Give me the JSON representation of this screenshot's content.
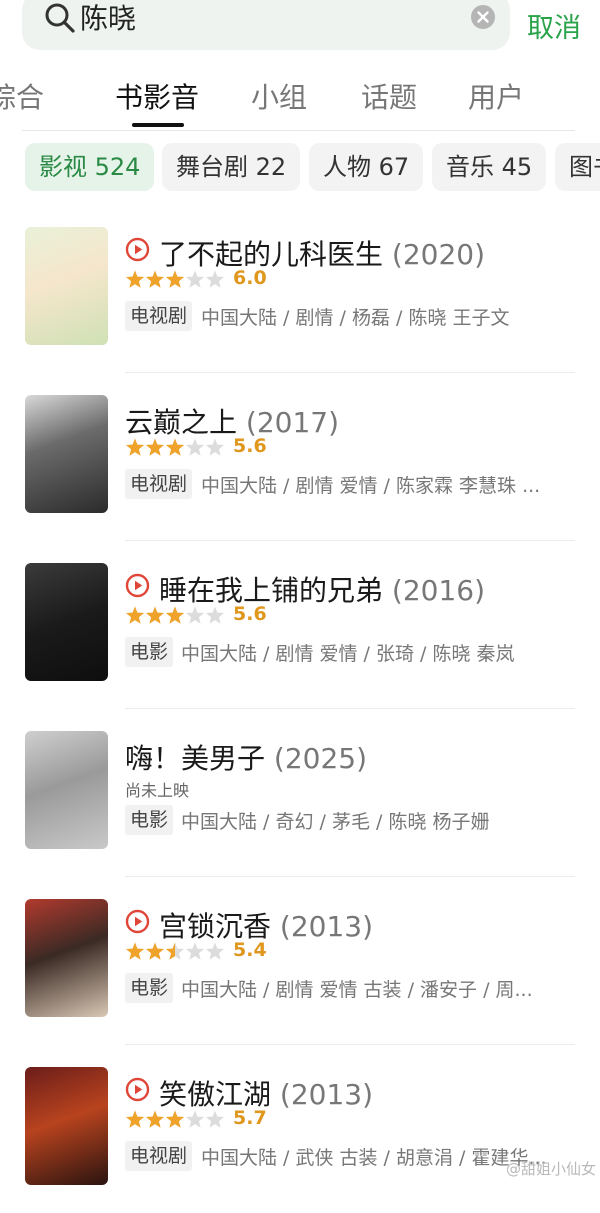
{
  "search": {
    "query": "陈晓",
    "cancel_label": "取消"
  },
  "tabs": [
    {
      "label": "综合",
      "active": false
    },
    {
      "label": "书影音",
      "active": true
    },
    {
      "label": "小组",
      "active": false
    },
    {
      "label": "话题",
      "active": false
    },
    {
      "label": "用户",
      "active": false
    }
  ],
  "filters": [
    {
      "label": "影视 524",
      "active": true
    },
    {
      "label": "舞台剧 22",
      "active": false
    },
    {
      "label": "人物 67",
      "active": false
    },
    {
      "label": "音乐 45",
      "active": false
    },
    {
      "label": "图书",
      "active": false
    }
  ],
  "results": [
    {
      "title": "了不起的儿科医生",
      "year": "(2020)",
      "playable": true,
      "stars": 3,
      "score": "6.0",
      "status": "",
      "type": "电视剧",
      "meta": "中国大陆 / 剧情 / 杨磊 / 陈晓 王子文"
    },
    {
      "title": "云巅之上",
      "year": "(2017)",
      "playable": false,
      "stars": 3,
      "score": "5.6",
      "status": "",
      "type": "电视剧",
      "meta": "中国大陆 / 剧情 爱情 / 陈家霖 李慧珠 ..."
    },
    {
      "title": "睡在我上铺的兄弟",
      "year": "(2016)",
      "playable": true,
      "stars": 3,
      "score": "5.6",
      "status": "",
      "type": "电影",
      "meta": "中国大陆 / 剧情 爱情 / 张琦 / 陈晓 秦岚"
    },
    {
      "title": "嗨！美男子",
      "year": "(2025)",
      "playable": false,
      "stars": 0,
      "score": "",
      "status": "尚未上映",
      "type": "电影",
      "meta": "中国大陆 / 奇幻 / 茅毛 / 陈晓 杨子姗"
    },
    {
      "title": "宫锁沉香",
      "year": "(2013)",
      "playable": true,
      "stars": 2.5,
      "score": "5.4",
      "status": "",
      "type": "电影",
      "meta": "中国大陆 / 剧情 爱情 古装 / 潘安子 / 周..."
    },
    {
      "title": "笑傲江湖",
      "year": "(2013)",
      "playable": true,
      "stars": 3,
      "score": "5.7",
      "status": "",
      "type": "电视剧",
      "meta": "中国大陆 / 武侠 古装 / 胡意涓 / 霍建华..."
    }
  ],
  "watermark": "@甜姐小仙女",
  "colors": {
    "accent": "#2aa34a",
    "star": "#f0a32a",
    "star_empty": "#dcdcdc",
    "play": "#e0453a"
  }
}
